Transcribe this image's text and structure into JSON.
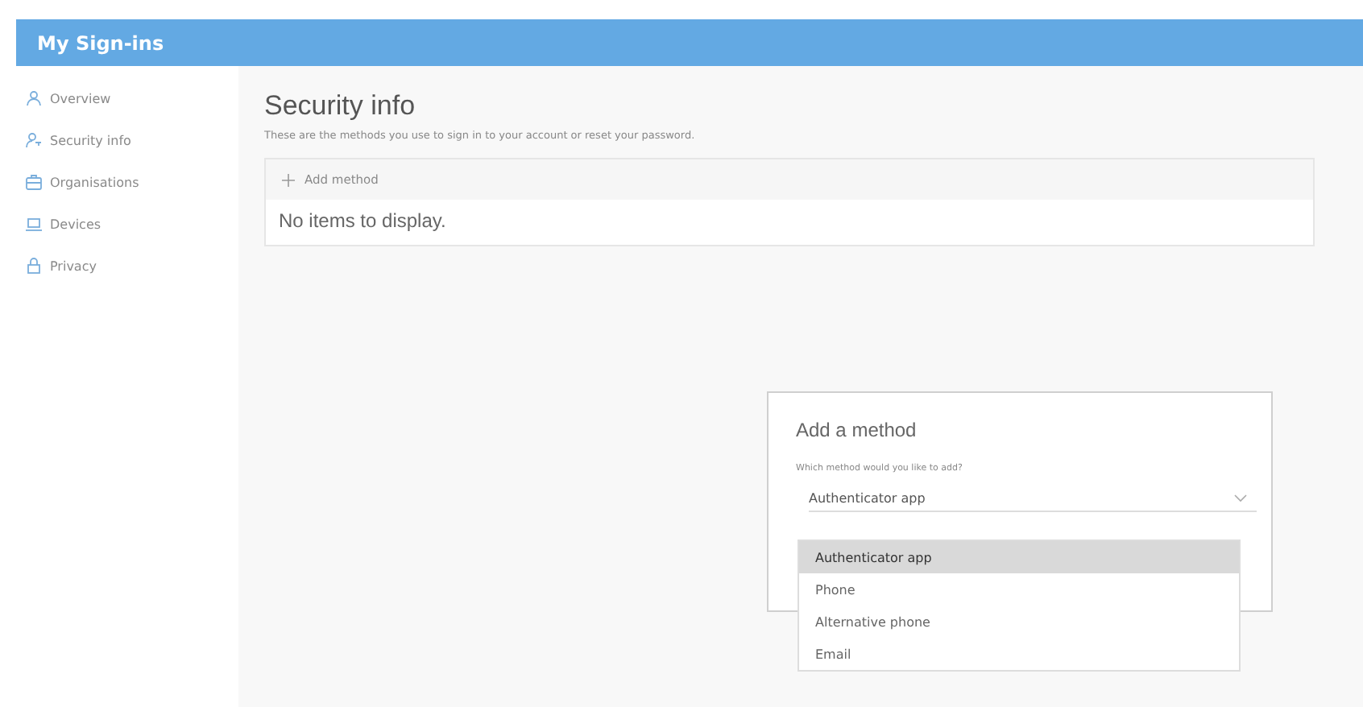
{
  "header": {
    "title": "My Sign-ins"
  },
  "sidebar": {
    "items": [
      {
        "label": "Overview",
        "kind": "person"
      },
      {
        "label": "Security info",
        "kind": "key"
      },
      {
        "label": "Organisations",
        "kind": "briefcase"
      },
      {
        "label": "Devices",
        "kind": "laptop"
      },
      {
        "label": "Privacy",
        "kind": "lock"
      }
    ]
  },
  "page": {
    "title": "Security info",
    "subtitle": "These are the methods you use to sign in to your account or reset your password.",
    "add_button": "Add method",
    "empty_text": "No items to display."
  },
  "dialog": {
    "title": "Add a method",
    "question": "Which method would you like to add?",
    "value": "Authenticator app",
    "options": [
      {
        "label": "Authenticator app",
        "selected": true
      },
      {
        "label": "Phone",
        "selected": false
      },
      {
        "label": "Alternative phone",
        "selected": false
      },
      {
        "label": "Email",
        "selected": false
      }
    ]
  }
}
